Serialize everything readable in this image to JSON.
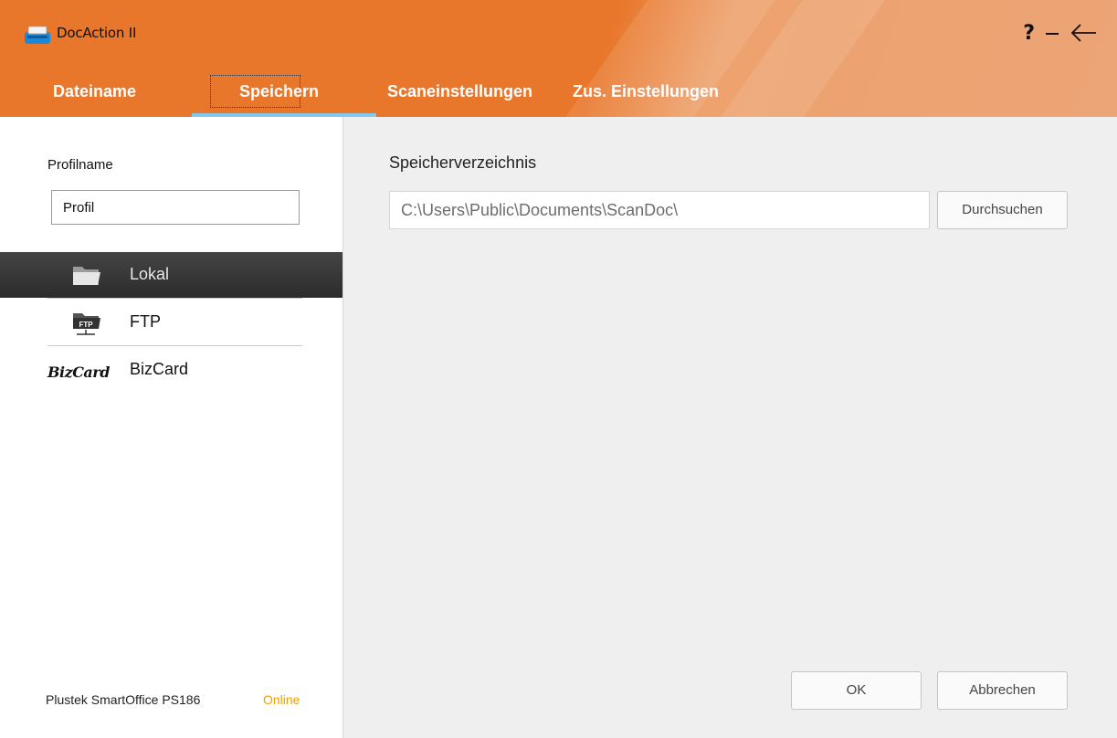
{
  "window": {
    "title": "DocAction",
    "title_version": "II",
    "help_label": "?",
    "icons": [
      "scanner-app-icon",
      "minimize-icon",
      "back-arrow-icon"
    ]
  },
  "tabs": [
    {
      "label": "Dateiname",
      "active": false
    },
    {
      "label": "Speichern",
      "active": true
    },
    {
      "label": "Scaneinstellungen",
      "active": false
    },
    {
      "label": "Zus. Einstellungen",
      "active": false
    }
  ],
  "sidebar": {
    "profile_label": "Profilname",
    "profile_value": "Profil",
    "destinations": [
      {
        "label": "Lokal",
        "icon": "folder-icon",
        "selected": true
      },
      {
        "label": "FTP",
        "icon": "ftp-icon",
        "icon_text": "FTP",
        "selected": false
      },
      {
        "label": "BizCard",
        "icon": "bizcard-logo",
        "icon_text": "BizCard",
        "selected": false
      }
    ],
    "device_name": "Plustek SmartOffice PS186",
    "device_status": "Online"
  },
  "main": {
    "directory_label": "Speicherverzeichnis",
    "directory_value": "C:\\Users\\Public\\Documents\\ScanDoc\\",
    "browse_label": "Durchsuchen",
    "ok_label": "OK",
    "cancel_label": "Abbrechen"
  },
  "colors": {
    "header_orange": "#e8772b",
    "tab_underline": "#86c7f0",
    "selected_item_bg": "#333333",
    "status_online": "#f0a000",
    "panel_bg": "#efefef"
  }
}
